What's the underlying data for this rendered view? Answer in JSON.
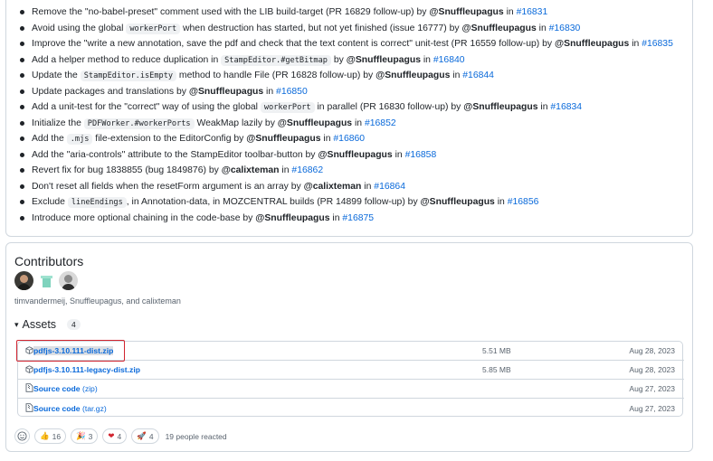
{
  "changes": [
    [
      {
        "t": "Remove the \"no-babel-preset\" comment used with the LIB build-target (PR 16829 follow-up) by "
      },
      {
        "t": "@Snuffleupagus",
        "k": "user"
      },
      {
        "t": " in "
      },
      {
        "t": "#16831",
        "k": "link"
      }
    ],
    [
      {
        "t": "Avoid using the global "
      },
      {
        "t": "workerPort",
        "k": "code"
      },
      {
        "t": " when destruction has started, but not yet finished (issue 16777) by "
      },
      {
        "t": "@Snuffleupagus",
        "k": "user"
      },
      {
        "t": " in "
      },
      {
        "t": "#16830",
        "k": "link"
      }
    ],
    [
      {
        "t": "Improve the \"write a new annotation, save the pdf and check that the text content is correct\" unit-test (PR 16559 follow-up) by "
      },
      {
        "t": "@Snuffleupagus",
        "k": "user"
      },
      {
        "t": " in "
      },
      {
        "t": "#16835",
        "k": "link"
      }
    ],
    [
      {
        "t": "Add a helper method to reduce duplication in "
      },
      {
        "t": "StampEditor.#getBitmap",
        "k": "code"
      },
      {
        "t": " by "
      },
      {
        "t": "@Snuffleupagus",
        "k": "user"
      },
      {
        "t": " in "
      },
      {
        "t": "#16840",
        "k": "link"
      }
    ],
    [
      {
        "t": "Update the "
      },
      {
        "t": "StampEditor.isEmpty",
        "k": "code"
      },
      {
        "t": " method to handle File (PR 16828 follow-up) by "
      },
      {
        "t": "@Snuffleupagus",
        "k": "user"
      },
      {
        "t": " in "
      },
      {
        "t": "#16844",
        "k": "link"
      }
    ],
    [
      {
        "t": "Update packages and translations by "
      },
      {
        "t": "@Snuffleupagus",
        "k": "user"
      },
      {
        "t": " in "
      },
      {
        "t": "#16850",
        "k": "link"
      }
    ],
    [
      {
        "t": "Add a unit-test for the \"correct\" way of using the global "
      },
      {
        "t": "workerPort",
        "k": "code"
      },
      {
        "t": " in parallel (PR 16830 follow-up) by "
      },
      {
        "t": "@Snuffleupagus",
        "k": "user"
      },
      {
        "t": " in "
      },
      {
        "t": "#16834",
        "k": "link"
      }
    ],
    [
      {
        "t": "Initialize the "
      },
      {
        "t": "PDFWorker.#workerPorts",
        "k": "code"
      },
      {
        "t": " WeakMap lazily by "
      },
      {
        "t": "@Snuffleupagus",
        "k": "user"
      },
      {
        "t": " in "
      },
      {
        "t": "#16852",
        "k": "link"
      }
    ],
    [
      {
        "t": "Add the "
      },
      {
        "t": ".mjs",
        "k": "code"
      },
      {
        "t": " file-extension to the EditorConfig by "
      },
      {
        "t": "@Snuffleupagus",
        "k": "user"
      },
      {
        "t": " in "
      },
      {
        "t": "#16860",
        "k": "link"
      }
    ],
    [
      {
        "t": "Add the \"aria-controls\" attribute to the StampEditor toolbar-button by "
      },
      {
        "t": "@Snuffleupagus",
        "k": "user"
      },
      {
        "t": " in "
      },
      {
        "t": "#16858",
        "k": "link"
      }
    ],
    [
      {
        "t": "Revert fix for bug 1838855 (bug 1849876) by "
      },
      {
        "t": "@calixteman",
        "k": "user"
      },
      {
        "t": " in "
      },
      {
        "t": "#16862",
        "k": "link"
      }
    ],
    [
      {
        "t": "Don't reset all fields when the resetForm argument is an array by "
      },
      {
        "t": "@calixteman",
        "k": "user"
      },
      {
        "t": " in "
      },
      {
        "t": "#16864",
        "k": "link"
      }
    ],
    [
      {
        "t": "Exclude "
      },
      {
        "t": "lineEndings",
        "k": "code"
      },
      {
        "t": ", in Annotation-data, in MOZCENTRAL builds (PR 14899 follow-up) by "
      },
      {
        "t": "@Snuffleupagus",
        "k": "user"
      },
      {
        "t": " in "
      },
      {
        "t": "#16856",
        "k": "link"
      }
    ],
    [
      {
        "t": "Introduce more optional chaining in the code-base by "
      },
      {
        "t": "@Snuffleupagus",
        "k": "user"
      },
      {
        "t": " in "
      },
      {
        "t": "#16875",
        "k": "link"
      }
    ]
  ],
  "contributors": {
    "title": "Contributors",
    "names": "timvandermeij, Snuffleupagus, and calixteman"
  },
  "assets": {
    "title": "Assets",
    "count": "4",
    "items": [
      {
        "name": "pdfjs-3.10.111-dist.zip",
        "size": "5.51 MB",
        "date": "Aug 28, 2023",
        "icon": "package-icon"
      },
      {
        "name": "pdfjs-3.10.111-legacy-dist.zip",
        "size": "5.85 MB",
        "date": "Aug 28, 2023",
        "icon": "package-icon"
      },
      {
        "name": "Source code",
        "sub": "(zip)",
        "size": "",
        "date": "Aug 27, 2023",
        "icon": "file-zip-icon"
      },
      {
        "name": "Source code",
        "sub": "(tar.gz)",
        "size": "",
        "date": "Aug 27, 2023",
        "icon": "file-zip-icon"
      }
    ]
  },
  "reactions": {
    "items": [
      {
        "emoji": "👍",
        "count": "16",
        "name": "thumbs-up"
      },
      {
        "emoji": "🎉",
        "count": "3",
        "name": "hooray"
      },
      {
        "emoji": "❤",
        "count": "4",
        "name": "heart"
      },
      {
        "emoji": "🚀",
        "count": "4",
        "name": "rocket"
      }
    ],
    "summary": "19 people reacted"
  }
}
